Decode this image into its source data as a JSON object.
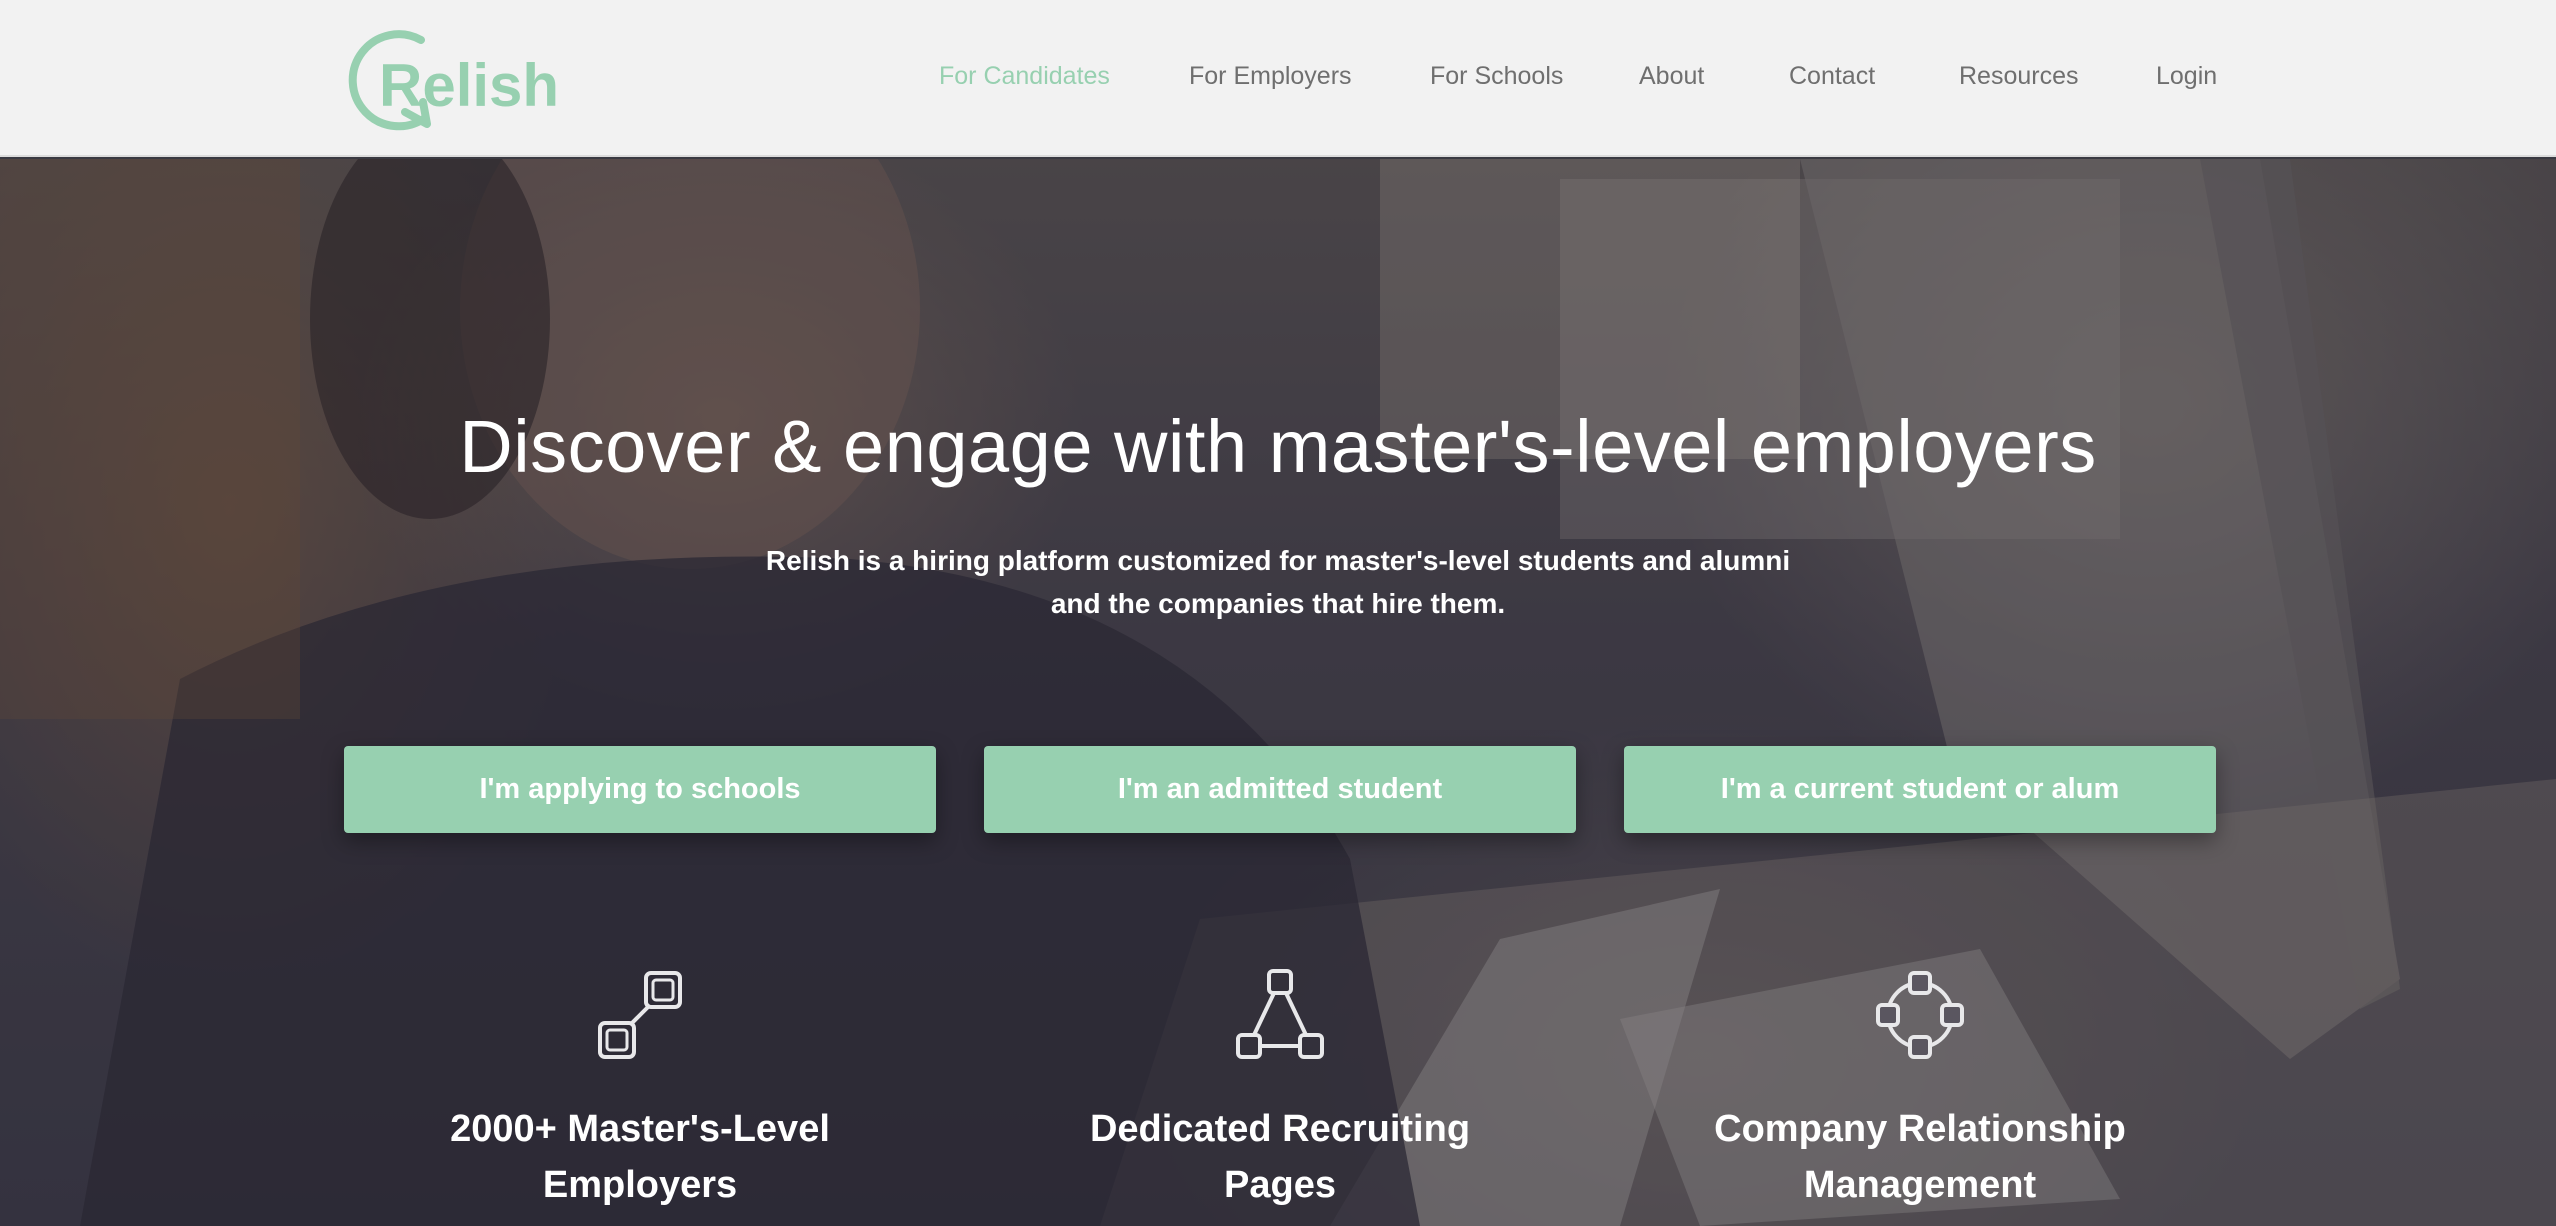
{
  "brand": {
    "name": "Relish",
    "color": "#97d0b0"
  },
  "nav": {
    "items": [
      {
        "label": "For Candidates",
        "active": true
      },
      {
        "label": "For Employers",
        "active": false
      },
      {
        "label": "For Schools",
        "active": false
      },
      {
        "label": "About",
        "active": false
      },
      {
        "label": "Contact",
        "active": false
      },
      {
        "label": "Resources",
        "active": false
      },
      {
        "label": "Login",
        "active": false
      }
    ]
  },
  "hero": {
    "headline": "Discover & engage with master's-level employers",
    "subline_1": "Relish is a hiring platform customized for master's-level students and alumni",
    "subline_2": "and the companies that hire them.",
    "buttons": [
      {
        "label": "I'm applying to schools"
      },
      {
        "label": "I'm an admitted student"
      },
      {
        "label": "I'm a current student or alum"
      }
    ]
  },
  "features": [
    {
      "icon": "link-nodes-icon",
      "title_1": "2000+ Master's-Level",
      "title_2": "Employers"
    },
    {
      "icon": "triangle-network-icon",
      "title_1": "Dedicated Recruiting",
      "title_2": "Pages"
    },
    {
      "icon": "circle-network-icon",
      "title_1": "Company Relationship",
      "title_2": "Management"
    }
  ],
  "colors": {
    "accent": "#97d0b0",
    "header_bg": "#f2f2f2",
    "nav_text": "#6f6f6f"
  }
}
